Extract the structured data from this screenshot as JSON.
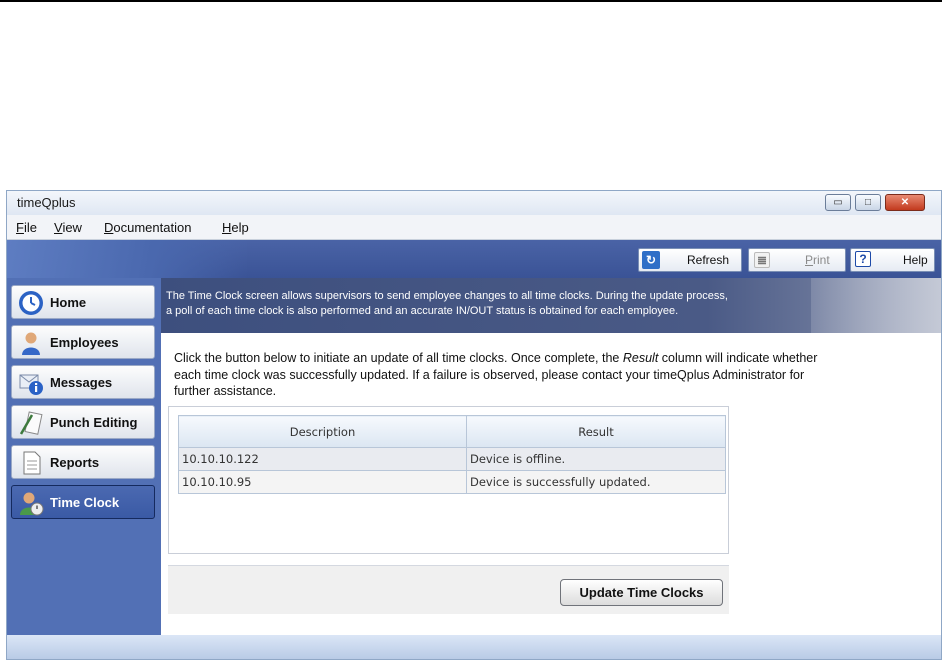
{
  "window": {
    "title": "timeQplus",
    "controls": {
      "minimize": "▭",
      "maximize": "□",
      "close": "✕"
    }
  },
  "menu": [
    {
      "label": "File",
      "accel": "F",
      "rest": "ile"
    },
    {
      "label": "View",
      "accel": "V",
      "rest": "iew"
    },
    {
      "label": "Documentation",
      "accel": "D",
      "rest": "ocumentation"
    },
    {
      "label": "Help",
      "accel": "H",
      "rest": "elp"
    }
  ],
  "toolbar": {
    "refresh": {
      "label": "Refresh",
      "icon": "refresh-icon",
      "glyph": "↻"
    },
    "print": {
      "label": "Print",
      "icon": "print-icon",
      "glyph": "≣",
      "accel": "P",
      "rest": "rint",
      "enabled": false
    },
    "help": {
      "label": "Help",
      "icon": "help-icon",
      "glyph": "?"
    }
  },
  "sidebar": {
    "items": [
      {
        "label": "Home",
        "icon": "clock-icon"
      },
      {
        "label": "Employees",
        "icon": "employee-icon"
      },
      {
        "label": "Messages",
        "icon": "messages-icon"
      },
      {
        "label": "Punch Editing",
        "icon": "punch-editing-icon"
      },
      {
        "label": "Reports",
        "icon": "reports-icon"
      },
      {
        "label": "Time Clock",
        "icon": "time-clock-icon",
        "active": true
      }
    ]
  },
  "banner": {
    "line1": "The Time Clock screen allows supervisors to send employee changes to all time clocks. During the update process,",
    "line2": "a poll of each time clock is also performed and an accurate IN/OUT status is obtained for each employee."
  },
  "instructions": {
    "part1": "Click the button below to initiate an update of all time clocks. Once complete, the ",
    "emph": "Result",
    "part2": " column will indicate whether each time clock was successfully updated. If a failure is observed, please contact your timeQplus Administrator for further assistance."
  },
  "table": {
    "headers": [
      "Description",
      "Result"
    ],
    "rows": [
      [
        "10.10.10.122",
        "Device is offline."
      ],
      [
        "10.10.10.95",
        "Device is successfully updated."
      ]
    ]
  },
  "actions": {
    "update_label": "Update Time Clocks"
  },
  "colors": {
    "sidebar": "#5270b5",
    "banner": "#3d4f7e",
    "active_nav": "#3a5aa5"
  }
}
